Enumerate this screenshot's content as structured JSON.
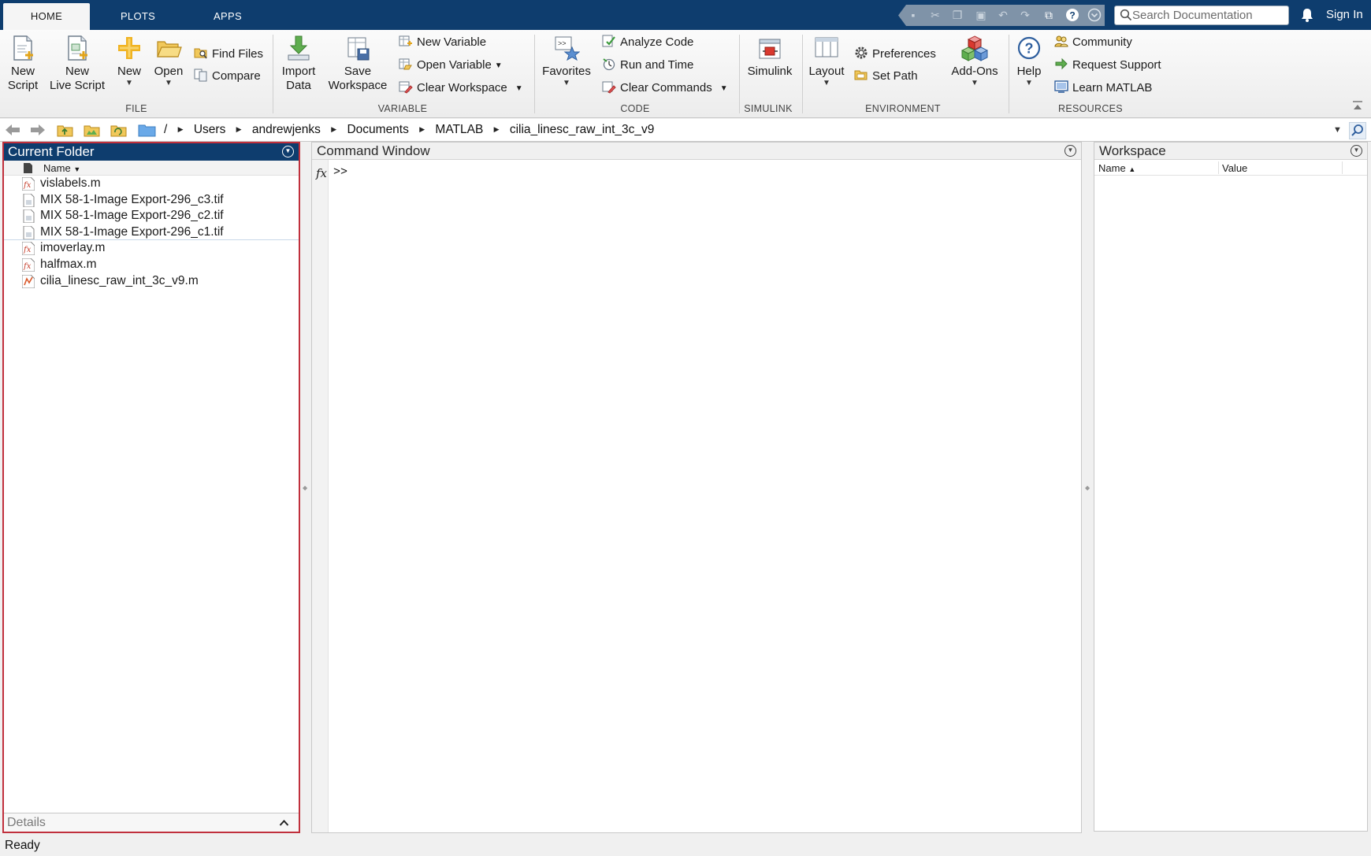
{
  "tabs": [
    {
      "label": "HOME"
    },
    {
      "label": "PLOTS"
    },
    {
      "label": "APPS"
    }
  ],
  "search": {
    "placeholder": "Search Documentation"
  },
  "signin": "Sign In",
  "ribbon": {
    "file": {
      "group_label": "FILE",
      "new_script": [
        "New",
        "Script"
      ],
      "new_live_script": [
        "New",
        "Live Script"
      ],
      "new": "New",
      "open": "Open",
      "find_files": "Find Files",
      "compare": "Compare"
    },
    "variable": {
      "group_label": "VARIABLE",
      "import_data": [
        "Import",
        "Data"
      ],
      "save_workspace": [
        "Save",
        "Workspace"
      ],
      "new_variable": "New Variable",
      "open_variable": "Open Variable",
      "clear_workspace": "Clear Workspace"
    },
    "code": {
      "group_label": "CODE",
      "favorites": "Favorites",
      "analyze_code": "Analyze Code",
      "run_and_time": "Run and Time",
      "clear_commands": "Clear Commands"
    },
    "simulink": {
      "group_label": "SIMULINK",
      "simulink": "Simulink"
    },
    "environment": {
      "group_label": "ENVIRONMENT",
      "layout": "Layout",
      "preferences": "Preferences",
      "set_path": "Set Path",
      "add_ons": "Add-Ons"
    },
    "resources": {
      "group_label": "RESOURCES",
      "help": "Help",
      "community": "Community",
      "request_support": "Request Support",
      "learn_matlab": "Learn MATLAB"
    }
  },
  "address": {
    "root": "/",
    "crumbs": [
      "Users",
      "andrewjenks",
      "Documents",
      "MATLAB",
      "cilia_linesc_raw_int_3c_v9"
    ]
  },
  "current_folder": {
    "title": "Current Folder",
    "column_name": "Name",
    "files": [
      {
        "name": "vislabels.m",
        "icon": "m-function-icon"
      },
      {
        "name": "MIX 58-1-Image Export-296_c3.tif",
        "icon": "image-file-icon"
      },
      {
        "name": "MIX 58-1-Image Export-296_c2.tif",
        "icon": "image-file-icon"
      },
      {
        "name": "MIX 58-1-Image Export-296_c1.tif",
        "icon": "image-file-icon"
      },
      {
        "name": "imoverlay.m",
        "icon": "m-function-icon"
      },
      {
        "name": "halfmax.m",
        "icon": "m-function-icon"
      },
      {
        "name": "cilia_linesc_raw_int_3c_v9.m",
        "icon": "m-script-icon"
      }
    ],
    "details": "Details"
  },
  "command_window": {
    "title": "Command Window",
    "fx": "fx",
    "prompt": ">>"
  },
  "workspace": {
    "title": "Workspace",
    "col_name": "Name",
    "col_value": "Value"
  },
  "status": "Ready",
  "colors": {
    "tab_bar": "#0e3d6e",
    "selection_border": "#c0303c"
  }
}
